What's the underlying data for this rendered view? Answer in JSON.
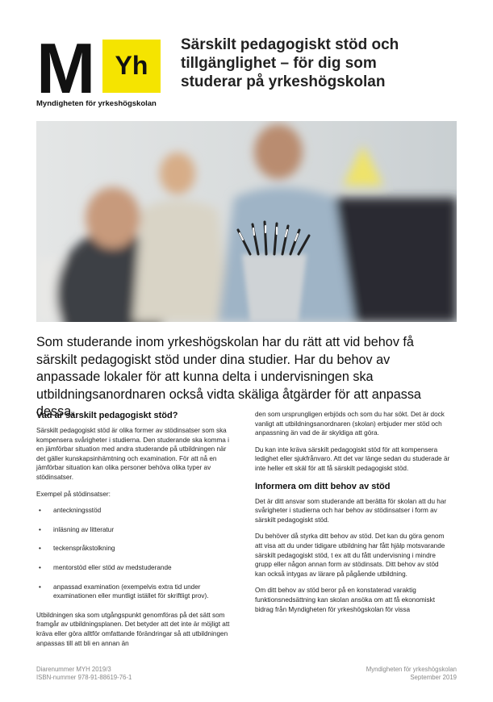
{
  "logo": {
    "letter": "M",
    "badge": "Yh",
    "caption": "Myndigheten för yrkeshögskolan",
    "badge_color": "#f5e400"
  },
  "title_lines": [
    "Särskilt pedagogiskt stöd och",
    "tillgänglighet – för dig som",
    "studerar på yrkeshögskolan"
  ],
  "intro": "Som studerande inom yrkeshögskolan har du rätt att vid behov få särskilt pedagogiskt stöd under dina studier. Har du behov av anpassade lokaler för att kunna delta i undervisningen ska utbildningsanordnaren också vidta skäliga åtgärder för att anpassa dessa.",
  "left": {
    "heading": "Vad är särskilt pedagogiskt stöd?",
    "p1": "Särskilt pedagogiskt stöd är olika former av stödinsatser som ska kompensera svårigheter i studierna. Den studerande ska komma i en jämförbar situation med andra studerande på utbildningen när det gäller kunskapsinhämtning och examination. För att nå en jämförbar situation kan olika personer behöva olika typer av stödinsatser.",
    "p2": "Exempel på stödinsatser:",
    "bullet": "•",
    "items": [
      "anteckningsstöd",
      "inläsning av litteratur",
      "teckenspråkstolkning",
      "mentorstöd eller stöd av medstuderande",
      "anpassad examination (exempelvis extra tid under examinationen eller muntligt istället för skriftligt prov)."
    ],
    "p3": "Utbildningen ska som utgångspunkt genomföras på det sätt som framgår av utbildningsplanen. Det betyder att det inte är möjligt att kräva eller göra alltför omfattande förändringar så att utbildningen anpassas till att bli en annan än"
  },
  "right": {
    "p1": "den som ursprungligen erbjöds och som du har sökt. Det är dock vanligt att utbildningsanordnaren (skolan) erbjuder mer stöd och anpassning än vad de är skyldiga att göra.",
    "p2": "Du kan inte kräva särskilt pedagogiskt stöd för att kompensera ledighet eller sjukfrånvaro. Att det var länge sedan du studerade är inte heller ett skäl för att få särskilt pedagogiskt stöd.",
    "heading": "Informera om ditt behov av stöd",
    "p3": "Det är ditt ansvar som studerande att berätta för skolan att du har svårigheter i studierna och har behov av stödinsatser i form av särskilt pedagogiskt stöd.",
    "p4": "Du behöver då styrka ditt behov av stöd. Det kan du göra genom att visa att du under tidigare utbildning har fått hjälp motsvarande särskilt pedagogiskt stöd, t ex att du fått undervisning i mindre grupp eller någon annan form av stödinsats. Ditt behov av stöd kan också intygas av lärare på pågående utbildning.",
    "p5": "Om ditt behov av stöd beror på en konstaterad varaktig funktionsnedsättning kan skolan ansöka om att få ekonomiskt bidrag från Myndigheten för yrkeshögskolan för vissa"
  },
  "footer": {
    "left_line1": "Diarenummer MYH 2019/3",
    "left_line2": "ISBN-nummer 978-91-88619-76-1",
    "right_line1": "Myndigheten för yrkeshögskolan",
    "right_line2": "September 2019"
  }
}
